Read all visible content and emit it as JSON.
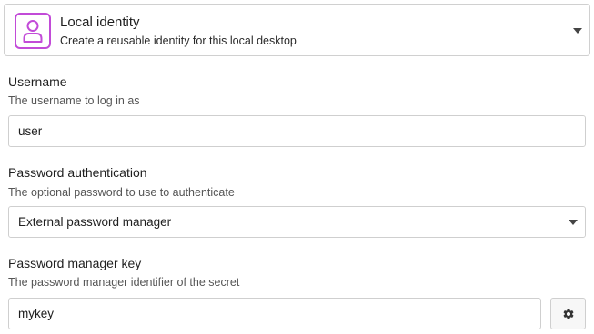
{
  "identity": {
    "title": "Local identity",
    "subtitle": "Create a reusable identity for this local desktop",
    "icon": "user-icon",
    "accent_color": "#c24bd8"
  },
  "username": {
    "label": "Username",
    "description": "The username to log in as",
    "value": "user"
  },
  "password_auth": {
    "label": "Password authentication",
    "description": "The optional password to use to authenticate",
    "selected": "External password manager"
  },
  "password_manager_key": {
    "label": "Password manager key",
    "description": "The password manager identifier of the secret",
    "value": "mykey",
    "settings_icon": "gear-icon"
  }
}
